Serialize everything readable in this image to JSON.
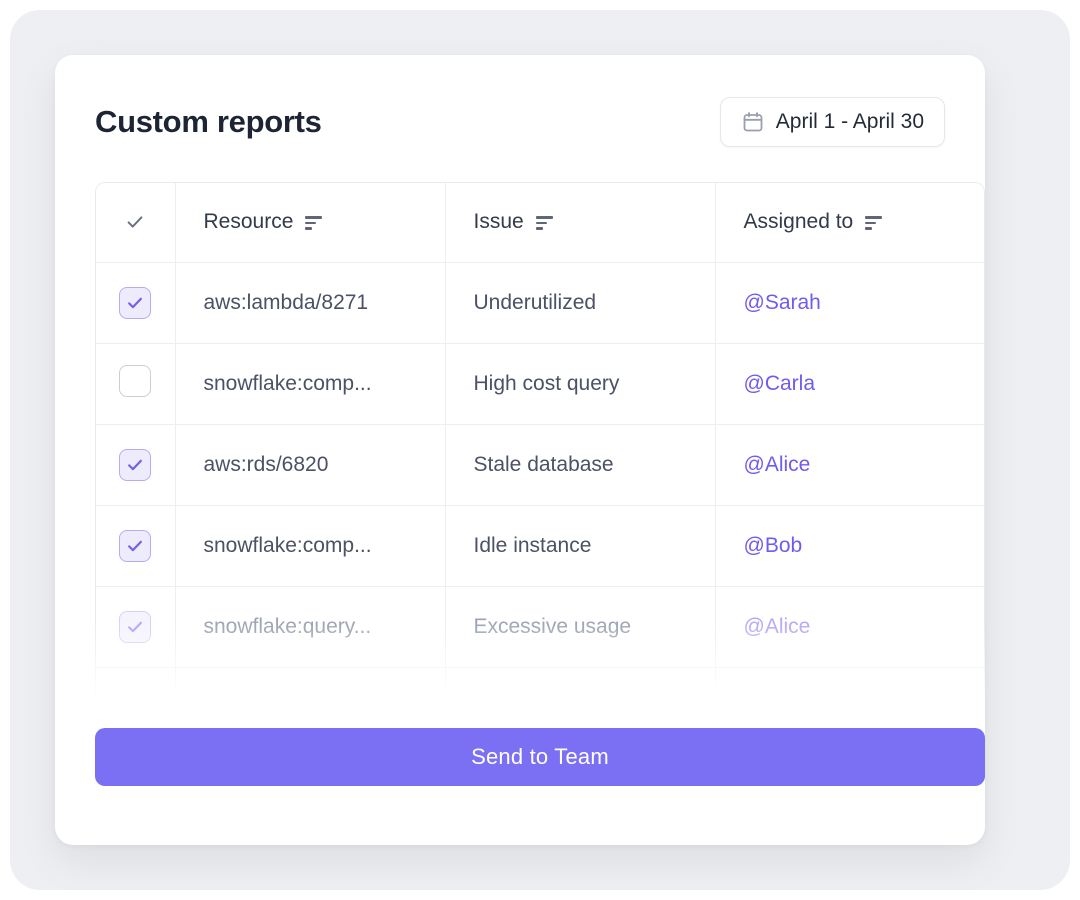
{
  "page": {
    "title": "Custom reports"
  },
  "date_range": {
    "label": "April 1 - April 30",
    "icon": "calendar-icon"
  },
  "table": {
    "select_column_icon": "check-icon",
    "columns": [
      {
        "label": "Resource",
        "sortable": true
      },
      {
        "label": "Issue",
        "sortable": true
      },
      {
        "label": "Assigned to",
        "sortable": true
      }
    ],
    "rows": [
      {
        "checked": true,
        "resource": "aws:lambda/8271",
        "issue": "Underutilized",
        "assignee": "@Sarah",
        "faded": false
      },
      {
        "checked": false,
        "resource": "snowflake:comp...",
        "issue": "High cost query",
        "assignee": "@Carla",
        "faded": false
      },
      {
        "checked": true,
        "resource": "aws:rds/6820",
        "issue": "Stale database",
        "assignee": "@Alice",
        "faded": false
      },
      {
        "checked": true,
        "resource": "snowflake:comp...",
        "issue": "Idle instance",
        "assignee": "@Bob",
        "faded": false
      },
      {
        "checked": true,
        "resource": "snowflake:query...",
        "issue": "Excessive usage",
        "assignee": "@Alice",
        "faded": true
      }
    ],
    "partial_row_visible": true
  },
  "actions": {
    "send_button_label": "Send to Team"
  },
  "colors": {
    "accent": "#7b6ff3",
    "mention": "#6e5cf0",
    "checkbox_checked_bg": "#edebfc",
    "checkbox_checked_border": "#b5acf3",
    "page_background": "#edeff2"
  }
}
